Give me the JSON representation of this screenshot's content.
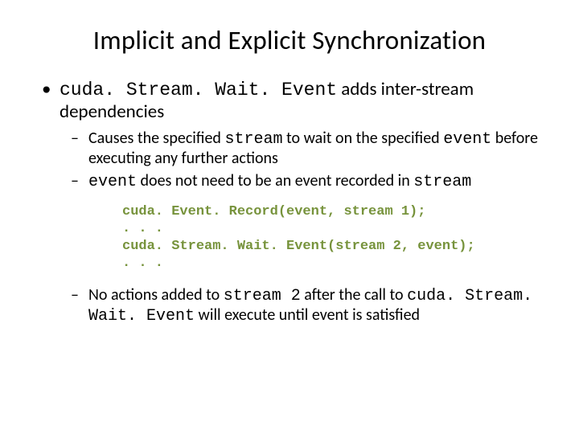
{
  "title": "Implicit and Explicit Synchronization",
  "bullet1": {
    "code1": "cuda. Stream. Wait. Event",
    "rest1": " adds inter-stream dependencies"
  },
  "sub1": {
    "a": "Causes the specified ",
    "b": "stream",
    "c": " to wait on the specified ",
    "d": "event",
    "e": " before executing any further actions"
  },
  "sub2": {
    "a": "event",
    "b": " does not need to be an event recorded in ",
    "c": "stream"
  },
  "code": "cuda. Event. Record(event, stream 1);\n. . .\ncuda. Stream. Wait. Event(stream 2, event);\n. . .",
  "sub3": {
    "a": "No actions added to ",
    "b": "stream 2",
    "c": " after the call to ",
    "d": "cuda. Stream. Wait. Event",
    "e": " will execute until event is satisfied"
  }
}
